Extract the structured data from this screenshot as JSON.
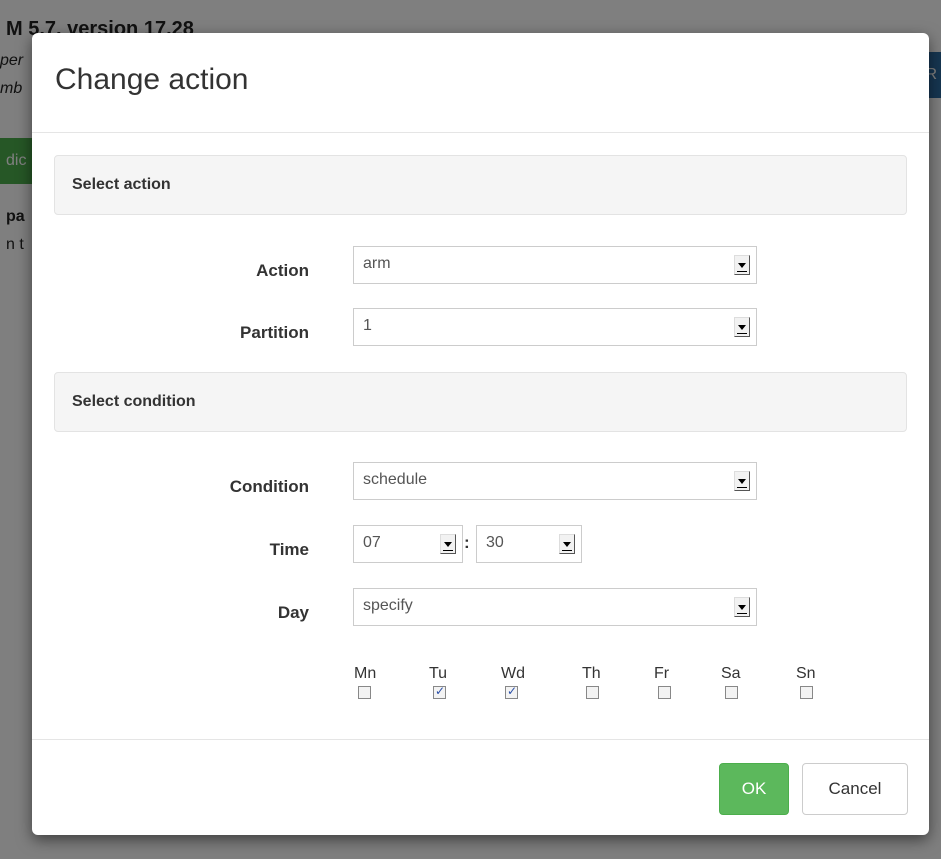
{
  "background": {
    "title": "M 5.7, version 17.28",
    "line1": "per",
    "line2": "mb",
    "green_button": "dic",
    "blue_button": "R",
    "bold_text": "pa",
    "text": "n t"
  },
  "modal": {
    "title": "Change action",
    "sections": {
      "action": "Select action",
      "condition": "Select condition"
    },
    "fields": {
      "action": {
        "label": "Action",
        "value": "arm"
      },
      "partition": {
        "label": "Partition",
        "value": "1"
      },
      "condition": {
        "label": "Condition",
        "value": "schedule"
      },
      "time": {
        "label": "Time",
        "hour": "07",
        "separator": ":",
        "minute": "30"
      },
      "day": {
        "label": "Day",
        "value": "specify"
      }
    },
    "days": [
      {
        "label": "Mn",
        "checked": false
      },
      {
        "label": "Tu",
        "checked": true
      },
      {
        "label": "Wd",
        "checked": true
      },
      {
        "label": "Th",
        "checked": false
      },
      {
        "label": "Fr",
        "checked": false
      },
      {
        "label": "Sa",
        "checked": false
      },
      {
        "label": "Sn",
        "checked": false
      }
    ],
    "footer": {
      "ok_label": "OK",
      "cancel_label": "Cancel"
    }
  },
  "colors": {
    "ok_button": "#5cb85c",
    "section_bg": "#f5f5f5",
    "backdrop": "rgba(0,0,0,0.5)"
  }
}
